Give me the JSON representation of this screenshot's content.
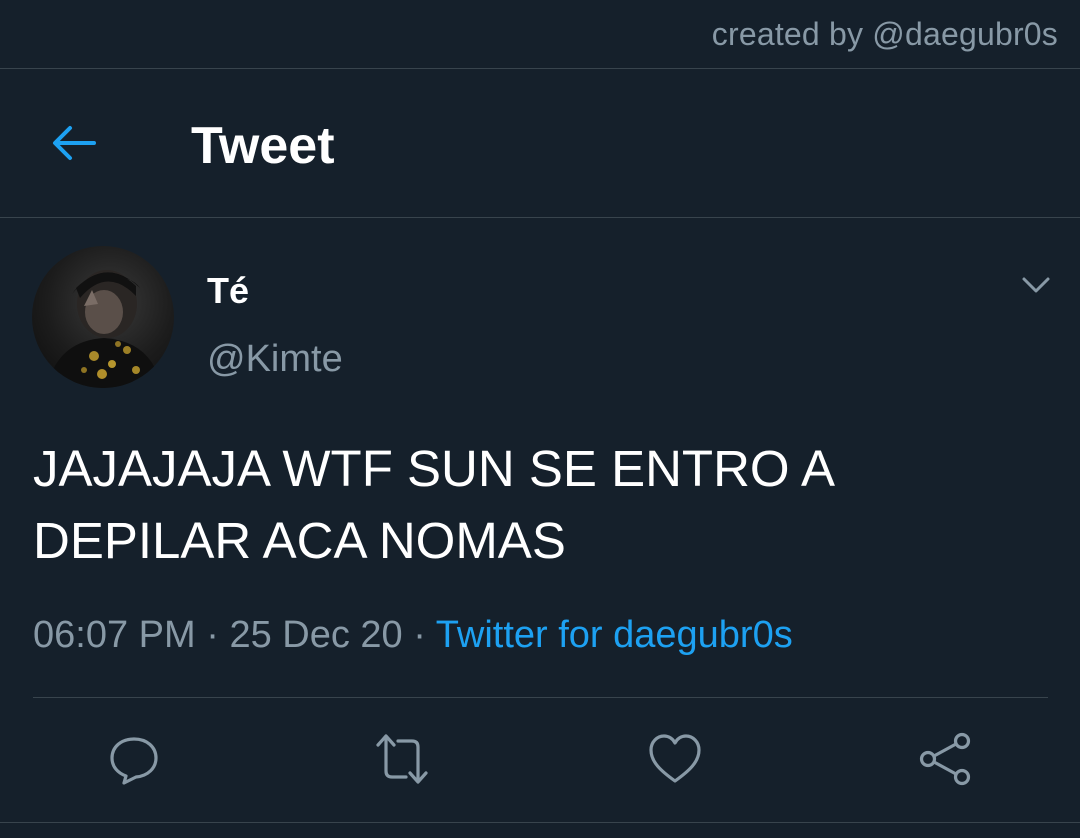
{
  "credit": "created by @daegubr0s",
  "header": {
    "title": "Tweet"
  },
  "tweet": {
    "display_name": "Té",
    "handle": "@Kimte",
    "text_line1": "JAJAJAJA WTF SUN SE ENTRO A",
    "text_line2": "DEPILAR ACA NOMAS",
    "time": "06:07 PM",
    "date": "25 Dec 20",
    "source": "Twitter for daegubr0s"
  },
  "colors": {
    "background": "#15202b",
    "accent": "#1da1f2",
    "secondary_text": "#8899a6",
    "border": "#38444d"
  },
  "icons": {
    "back": "arrow-left-icon",
    "more": "chevron-down-icon",
    "reply": "reply-icon",
    "retweet": "retweet-icon",
    "like": "heart-icon",
    "share": "share-icon"
  }
}
